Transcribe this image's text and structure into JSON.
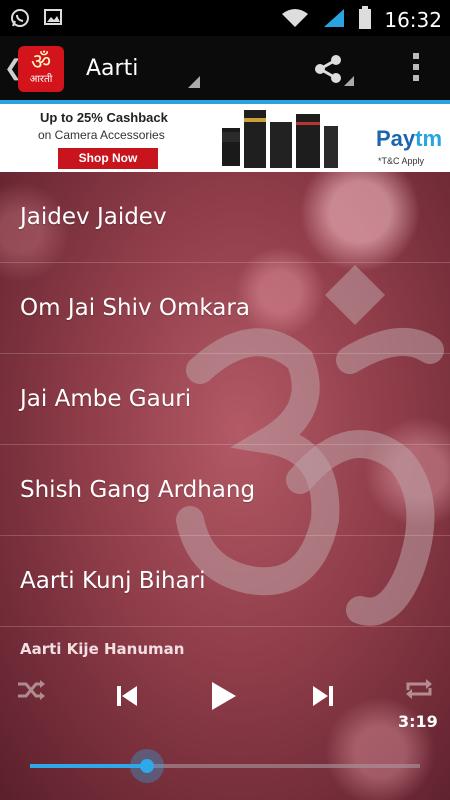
{
  "status_bar": {
    "time": "16:32",
    "icons": [
      "whatsapp-icon",
      "image-icon",
      "wifi-icon",
      "signal-icon",
      "battery-icon"
    ]
  },
  "action_bar": {
    "app_logo_om": "ॐ",
    "app_logo_text": "आरती",
    "title": "Aarti",
    "accent_color": "#2ba3e0"
  },
  "ad": {
    "line1": "Up to 25% Cashback",
    "line2": "on Camera Accessories",
    "button": "Shop Now",
    "brand_pay": "Pay",
    "brand_tm": "tm",
    "tnc": "*T&C Apply"
  },
  "songs": [
    {
      "title": "Jaidev Jaidev"
    },
    {
      "title": "Om Jai Shiv Omkara"
    },
    {
      "title": "Jai Ambe Gauri"
    },
    {
      "title": "Shish Gang Ardhang"
    },
    {
      "title": "Aarti Kunj Bihari"
    }
  ],
  "player": {
    "now_playing": "Aarti Kije Hanuman",
    "duration": "3:19",
    "progress": 0.3,
    "progress_color": "#2ea8e6"
  }
}
